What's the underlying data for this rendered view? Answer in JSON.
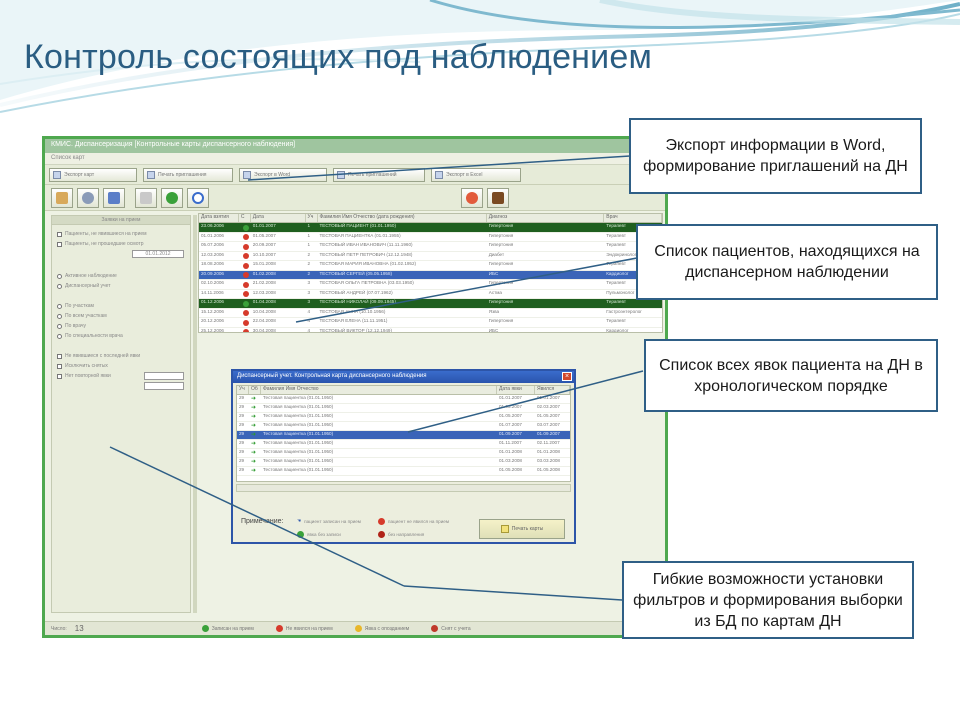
{
  "slide": {
    "title": "Контроль состоящих под наблюдением"
  },
  "app": {
    "window_title": "КМИС. Диспансеризация [Контрольные карты диспансерного наблюдения]",
    "menu": "Список карт",
    "toolbar": [
      {
        "label": "Экспорт карт"
      },
      {
        "label": "Печать приглашения"
      },
      {
        "label": "Экспорт в Word"
      },
      {
        "label": "Печать приглашений"
      },
      {
        "label": "Экспорт в Excel"
      }
    ],
    "filter_panel": {
      "header": "Заявки на прием",
      "options": [
        "Пациенты, не явившиеся на прием",
        "Пациенты, не прошедшие осмотр",
        "Активное наблюдение",
        "Диспансерный учет",
        "По участкам",
        "По всем участкам",
        "По врачу",
        "По специальности врача",
        "Не явившиеся с последней явки",
        "Исключить снятых",
        "Нет повторной явки"
      ],
      "date_value": "01.01.2012"
    },
    "grid": {
      "columns": [
        "Дата взятия",
        "С",
        "Дата",
        "Уч",
        "Фамилия Имя Отчество (дата рождения)",
        "Диагноз",
        "Врач"
      ],
      "rows": [
        {
          "date": "23.06.2006",
          "ok": true,
          "date2": "01.01.2007",
          "uch": "1",
          "name": "ТЕСТОВЫЙ ПАЦИЕНТ (01.01.1950)",
          "diag": "Гипертония",
          "doc": "Терапевт",
          "hl": "dark"
        },
        {
          "date": "01.01.2006",
          "ok": false,
          "date2": "01.05.2007",
          "uch": "1",
          "name": "ТЕСТОВАЯ ПАЦИЕНТКА (01.01.1955)",
          "diag": "Гипертония",
          "doc": "Терапевт",
          "hl": ""
        },
        {
          "date": "05.07.2006",
          "ok": false,
          "date2": "20.09.2007",
          "uch": "1",
          "name": "ТЕСТОВЫЙ ИВАН ИВАНОВИЧ (11.11.1960)",
          "diag": "Гипертония",
          "doc": "Терапевт",
          "hl": ""
        },
        {
          "date": "12.03.2006",
          "ok": false,
          "date2": "10.10.2007",
          "uch": "2",
          "name": "ТЕСТОВЫЙ ПЕТР ПЕТРОВИЧ (12.12.1948)",
          "diag": "Диабет",
          "doc": "Эндокринолог",
          "hl": ""
        },
        {
          "date": "18.08.2006",
          "ok": false,
          "date2": "15.01.2008",
          "uch": "2",
          "name": "ТЕСТОВАЯ МАРИЯ ИВАНОВНА (01.02.1952)",
          "diag": "Гипертония",
          "doc": "Терапевт",
          "hl": ""
        },
        {
          "date": "20.09.2006",
          "ok": false,
          "date2": "01.02.2008",
          "uch": "2",
          "name": "ТЕСТОВЫЙ СЕРГЕЙ (05.05.1958)",
          "diag": "ИБС",
          "doc": "Кардиолог",
          "hl": "blue"
        },
        {
          "date": "02.10.2006",
          "ok": false,
          "date2": "21.02.2008",
          "uch": "3",
          "name": "ТЕСТОВАЯ ОЛЬГА ПЕТРОВНА (03.03.1950)",
          "diag": "Гипертония",
          "doc": "Терапевт",
          "hl": ""
        },
        {
          "date": "14.11.2006",
          "ok": false,
          "date2": "12.03.2008",
          "uch": "3",
          "name": "ТЕСТОВЫЙ АНДРЕЙ (07.07.1962)",
          "diag": "Астма",
          "doc": "Пульмонолог",
          "hl": ""
        },
        {
          "date": "01.12.2006",
          "ok": true,
          "date2": "01.04.2008",
          "uch": "3",
          "name": "ТЕСТОВЫЙ НИКОЛАЙ (09.09.1945)",
          "diag": "Гипертония",
          "doc": "Терапевт",
          "hl": "dark"
        },
        {
          "date": "15.12.2006",
          "ok": false,
          "date2": "10.04.2008",
          "uch": "4",
          "name": "ТЕСТОВАЯ АННА (10.10.1956)",
          "diag": "Язва",
          "doc": "Гастроэнтеролог",
          "hl": ""
        },
        {
          "date": "20.12.2006",
          "ok": false,
          "date2": "22.04.2008",
          "uch": "4",
          "name": "ТЕСТОВАЯ ЕЛЕНА (11.11.1951)",
          "diag": "Гипертония",
          "doc": "Терапевт",
          "hl": ""
        },
        {
          "date": "25.12.2006",
          "ok": false,
          "date2": "30.04.2008",
          "uch": "4",
          "name": "ТЕСТОВЫЙ ВИКТОР (12.12.1949)",
          "diag": "ИБС",
          "doc": "Кардиолог",
          "hl": ""
        }
      ]
    },
    "status": {
      "count_label": "Число:",
      "count": "13",
      "legend": [
        "Записан на прием",
        "Не явился на прием",
        "Явка с опозданием",
        "Снят с учета"
      ]
    }
  },
  "dialog": {
    "title": "Диспансерный учет. Контрольная карта диспансерного наблюдения",
    "columns": [
      "Уч",
      "Об",
      "Фамилия Имя Отчество",
      "Дата явки",
      "Явился"
    ],
    "rows": [
      {
        "uch": "29",
        "name": "Тестовая пациентка (01.01.1950)",
        "d1": "01.01.2007",
        "d2": "01.01.2007",
        "hl": false
      },
      {
        "uch": "29",
        "name": "Тестовая пациентка (01.01.1950)",
        "d1": "01.03.2007",
        "d2": "02.03.2007",
        "hl": false
      },
      {
        "uch": "29",
        "name": "Тестовая пациентка (01.01.1950)",
        "d1": "01.05.2007",
        "d2": "01.05.2007",
        "hl": false
      },
      {
        "uch": "29",
        "name": "Тестовая пациентка (01.01.1950)",
        "d1": "01.07.2007",
        "d2": "03.07.2007",
        "hl": false
      },
      {
        "uch": "29",
        "name": "Тестовая пациентка (01.01.1950)",
        "d1": "01.09.2007",
        "d2": "01.09.2007",
        "hl": true
      },
      {
        "uch": "29",
        "name": "Тестовая пациентка (01.01.1950)",
        "d1": "01.11.2007",
        "d2": "02.11.2007",
        "hl": false
      },
      {
        "uch": "29",
        "name": "Тестовая пациентка (01.01.1950)",
        "d1": "01.01.2008",
        "d2": "01.01.2008",
        "hl": false
      },
      {
        "uch": "29",
        "name": "Тестовая пациентка (01.01.1950)",
        "d1": "01.03.2008",
        "d2": "03.03.2008",
        "hl": false
      },
      {
        "uch": "29",
        "name": "Тестовая пациентка (01.01.1950)",
        "d1": "01.05.2008",
        "d2": "01.05.2008",
        "hl": false
      }
    ],
    "note": "Примечание:",
    "legend": [
      "пациент записан на прием",
      "пациент не явился на прием",
      "явка без записи",
      "без направления"
    ],
    "button": "Печать карты"
  },
  "callouts": {
    "export": "Экспорт информации в Word, формирование приглашений на ДН",
    "patients": "Список пациентов, находящихся на диспансерном наблюдении",
    "visits": "Список всех явок пациента на ДН в хронологическом порядке",
    "filters": "Гибкие возможности установки фильтров и формирования выборки из БД по картам ДН"
  },
  "colors": {
    "title": "#2a5d82",
    "frame": "#4fa84f",
    "callout_border": "#2f5f86",
    "row_dark": "#1f5f1f",
    "row_selected": "#3a65b8"
  }
}
